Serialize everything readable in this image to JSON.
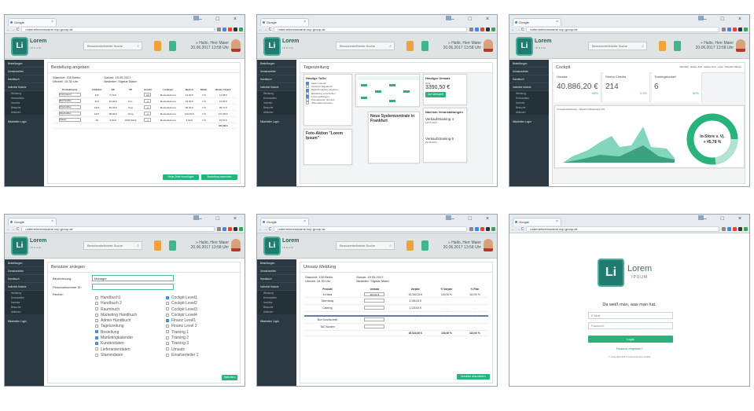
{
  "browser": {
    "tab_title": "Google",
    "url": "unternehmensname.ncp-group.de",
    "win_buttons": "– □ ×"
  },
  "app": {
    "logo_letters": "Li",
    "logo_name": "Lorem",
    "logo_sub": "IPSUM",
    "search_placeholder": "Benutzerdefinierte Suche",
    "greeting": "» Hallo, Herr Maier",
    "datetime": "20.06.2017 13:58 Uhr"
  },
  "sidebar": {
    "items": [
      "Bestellungen",
      "Umsatzzahlen",
      "Handbuch",
      "Indirekte Module"
    ],
    "subitems": [
      "Werbung",
      "Kennzahlen",
      "Inventur",
      "Besuche",
      "Aktionen"
    ],
    "logout": "Mitarbeiter Login"
  },
  "screen1": {
    "title": "Bestellung angeben",
    "standort": "Standort: 105 Berlin",
    "uhrzeit": "Uhrzeit: 15.30 Uhr",
    "datum": "Datum: 15.05.2017",
    "besteller": "Besteller: Sigmar Maier",
    "columns": [
      "Produktname",
      "Artikelnr.",
      "EK",
      "VP",
      "Anzahl",
      "Lieferant",
      "Netto €",
      "MwSt.",
      "Brutto Total €"
    ],
    "rows": [
      [
        "Computer4",
        "132",
        "0,70 €",
        "",
        "20",
        "Musterlieferant",
        "14,00 €",
        "7 %",
        "14,98 €"
      ],
      [
        "Milchkaffee",
        "423",
        "10,00 €",
        "10 L",
        "1",
        "Musterlieferant",
        "10,00 €",
        "7 %",
        "10,50 €"
      ],
      [
        "Filterkaffee",
        "1323",
        "95,30 €",
        "5 kg",
        "1",
        "Musterlieferant",
        "95,30 €",
        "7 %",
        "95,71 €"
      ],
      [
        "Filterkaffee",
        "1327",
        "98,00 €",
        "10 kg",
        "1",
        "Musterlieferant",
        "100,00 €",
        "7 %",
        "101,00 €"
      ],
      [
        "Kakao",
        "28",
        "5,00 €",
        "1000 Stück",
        "1",
        "Musterlieferant",
        "5,00 €",
        "7 %",
        "15,62 €"
      ]
    ],
    "total": "374,00 €",
    "btn_add": "Neue Zeile hinzufügen",
    "btn_submit": "Bestellung absenden"
  },
  "screen2": {
    "title": "Tageszeitung",
    "tile_todo": "Heutige ToDo",
    "todo_items": [
      "Zettel notieren",
      "Lieferant Tagesbuch",
      "Bedarfsmeldung abgeben",
      "Bestellung verschicken",
      "Fresh aufhängen",
      "Preisetiketten drucken",
      "Warenlisten drucken"
    ],
    "sales_title": "Heutiger Umsatz",
    "sales_label": "Total",
    "sales_value": "3390,50 €",
    "sales_btn": "Zur Übersicht",
    "events_title": "Nächste Veranstaltungen",
    "event1": "Verkaufstraining 4",
    "event1_date": "13.07.2017",
    "event2": "Verkaufstraining 5",
    "event2_date": "20.08.2017",
    "promo": "Foto-Aktion \"Lorem Ipsum\"",
    "news": "Neue Systemzentrale in Frankfurt"
  },
  "screen3": {
    "title": "Cockpit",
    "filters": [
      "Standort",
      "Geben Sort",
      "Geben Sort",
      "Land",
      "Transformatione"
    ],
    "kpi1_label": "Umsatz",
    "kpi1_value": "40.886,20 €",
    "kpi1_pct": "98%",
    "kpi2_label": "Storno Checks",
    "kpi2_value": "214",
    "kpi2_pct": "0,3%",
    "kpi3_label": "Trainingsbedarf",
    "kpi3_value": "6",
    "kpi3_pct": "50%",
    "chart_title": "Umsatzentwicklung - Standort Wittenberg 103",
    "donut_label": "In-Store v. Vj.",
    "donut_value": "+ 45,78 %"
  },
  "screen4": {
    "title": "Benutzer anlegen",
    "label_name": "Bezeichnung:",
    "value_name": "Manager",
    "label_id": "Personalnummer ID:",
    "label_rights": "Rechte:",
    "rights_col1": [
      "Handbuch1",
      "Handbuch 2",
      "Raumbuch",
      "Marketing Handbuch",
      "Admin Handbuch",
      "Tageszeitung",
      "Bestellung",
      "Marketingkalender",
      "Kundendaten",
      "Lieferantendaten",
      "Stammdaten"
    ],
    "rights_col2": [
      "Cockpit Level1",
      "Cockpit Level2",
      "Cockpit Level3",
      "Cockpit Level4",
      "Finanz Level1",
      "Finanz Level 2",
      "Training 1",
      "Training 2",
      "Training 3",
      "Umsatz",
      "Emailverteiler 1"
    ],
    "btn": "Speichern"
  },
  "screen5": {
    "title": "Umsatz Meldung",
    "standort": "Standort: 105 Berlin",
    "uhrzeit": "Uhrzeit: 15.30 Uhr",
    "datum": "Datum: 15.05.2017",
    "besteller": "Besteller: Sigmar Maier",
    "columns": [
      "Produkt",
      "Umsatz",
      "Vorjahr",
      "% Vorjahr",
      "% Plan"
    ],
    "rows": [
      [
        "In Haus",
        "984,00 €",
        "15.350,00 €",
        "100,00 %",
        "110,00 %"
      ],
      [
        "Take Away",
        "",
        "3.156,00 €",
        "-",
        "-"
      ],
      [
        "Catering",
        "",
        "1.133,00 €",
        "-",
        "-"
      ]
    ],
    "rows2": [
      "Bon Durchschnitt",
      "TAC Kunden"
    ],
    "total": [
      "16.324,00 €",
      "100,00 %",
      "110,00 %"
    ],
    "btn": "Umsätze abschließen"
  },
  "screen6": {
    "heading": "Da weiß man, was man hat.",
    "email_placeholder": "E-Mail",
    "password_placeholder": "Passwort",
    "btn": "Login",
    "forgot": "Passwort vergessen?",
    "copyright": "© Copyright 2017 Unternehmens GmbH"
  }
}
